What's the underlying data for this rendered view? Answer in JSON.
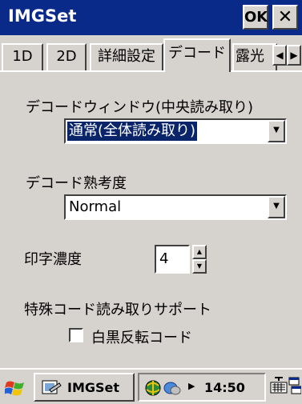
{
  "window": {
    "title": "IMGSet",
    "ok_label": "OK",
    "close_label": "✕"
  },
  "tabs": [
    {
      "label": "1D"
    },
    {
      "label": "2D"
    },
    {
      "label": "詳細設定"
    },
    {
      "label": "デコード",
      "active": true
    },
    {
      "label": "露光"
    }
  ],
  "decode_window": {
    "label": "デコードウィンドウ(中央読み取り)",
    "value": "通常(全体読み取り)"
  },
  "decode_thinking": {
    "label": "デコード熟考度",
    "value": "Normal"
  },
  "print_density": {
    "label": "印字濃度",
    "value": "4"
  },
  "special_code": {
    "label": "特殊コード読み取りサポート",
    "checkbox_label": "白黒反転コード",
    "checked": false
  },
  "taskbar": {
    "task_label": "IMGSet",
    "time": "14:50"
  },
  "colors": {
    "titlebar": "#0a2a8a",
    "face": "#d6d3ce",
    "selection": "#0a246a"
  }
}
